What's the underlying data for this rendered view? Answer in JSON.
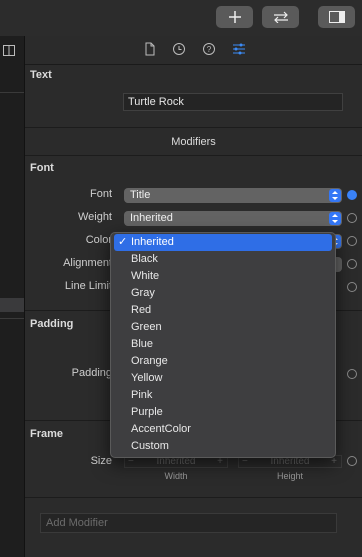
{
  "toolbar": {
    "add_icon": "plus-icon",
    "swap_icon": "swap-arrows-icon",
    "panel_icon": "sidebar-panel-icon"
  },
  "inspector_tabs": [
    "file-icon",
    "clock-icon",
    "help-icon",
    "sliders-icon"
  ],
  "text_section": {
    "title": "Text",
    "value": "Turtle Rock"
  },
  "modifiers": {
    "title": "Modifiers"
  },
  "font_section": {
    "title": "Font",
    "font_label": "Font",
    "font_value": "Title",
    "weight_label": "Weight",
    "weight_value": "Inherited",
    "color_label": "Color",
    "alignment_label": "Alignment",
    "line_limit_label": "Line Limit"
  },
  "padding_section": {
    "title": "Padding",
    "padding_label": "Padding"
  },
  "frame_section": {
    "title": "Frame",
    "size_label": "Size",
    "width_value": "Inherited",
    "height_value": "Inherited",
    "width_label": "Width",
    "height_label": "Height"
  },
  "color_menu": {
    "selected": "Inherited",
    "items": [
      "Inherited",
      "Black",
      "White",
      "Gray",
      "Red",
      "Green",
      "Blue",
      "Orange",
      "Yellow",
      "Pink",
      "Purple",
      "AccentColor",
      "Custom"
    ]
  },
  "add_modifier": {
    "placeholder": "Add Modifier"
  },
  "colors": {
    "accent": "#3477f6",
    "menu_bg": "#3e3e40"
  }
}
